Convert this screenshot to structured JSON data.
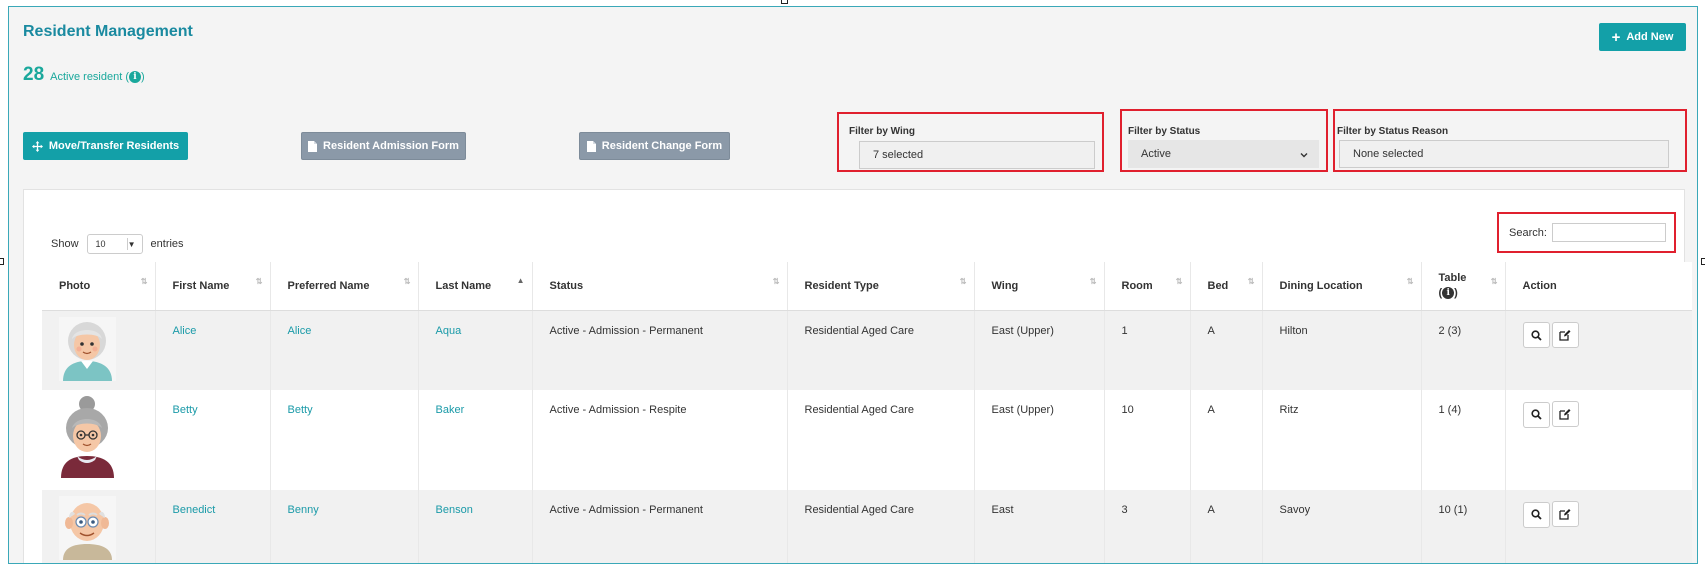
{
  "page_title": "Resident Management",
  "active_count": "28",
  "active_label": "Active resident (",
  "active_label_close": ")",
  "add_new": "Add New",
  "move_transfer": "Move/Transfer Residents",
  "admission_form": "Resident Admission Form",
  "change_form": "Resident Change Form",
  "filters": {
    "wing": {
      "label": "Filter by Wing",
      "value": "7 selected"
    },
    "status": {
      "label": "Filter by Status",
      "value": "Active"
    },
    "reason": {
      "label": "Filter by Status Reason",
      "value": "None selected"
    }
  },
  "table_controls": {
    "show": "Show",
    "entries_value": "10",
    "entries": "entries",
    "search": "Search:"
  },
  "columns": [
    "Photo",
    "First Name",
    "Preferred Name",
    "Last Name",
    "Status",
    "Resident Type",
    "Wing",
    "Room",
    "Bed",
    "Dining Location",
    "Table",
    "Action"
  ],
  "table_paren_open": "(",
  "table_paren_close": ")",
  "rows": [
    {
      "first": "Alice",
      "preferred": "Alice",
      "last": "Aqua",
      "status": "Active - Admission - Permanent",
      "type": "Residential Aged Care",
      "wing": "East (Upper)",
      "room": "1",
      "bed": "A",
      "dining": "Hilton",
      "table": "2 (3)"
    },
    {
      "first": "Betty",
      "preferred": "Betty",
      "last": "Baker",
      "status": "Active - Admission - Respite",
      "type": "Residential Aged Care",
      "wing": "East (Upper)",
      "room": "10",
      "bed": "A",
      "dining": "Ritz",
      "table": "1 (4)"
    },
    {
      "first": "Benedict",
      "preferred": "Benny",
      "last": "Benson",
      "status": "Active - Admission - Permanent",
      "type": "Residential Aged Care",
      "wing": "East",
      "room": "3",
      "bed": "A",
      "dining": "Savoy",
      "table": "10 (1)"
    }
  ],
  "colors": {
    "accent": "#13a0a8",
    "link": "#1a9aa8",
    "highlight": "#e0202e",
    "grey_button": "#8b99a8"
  }
}
